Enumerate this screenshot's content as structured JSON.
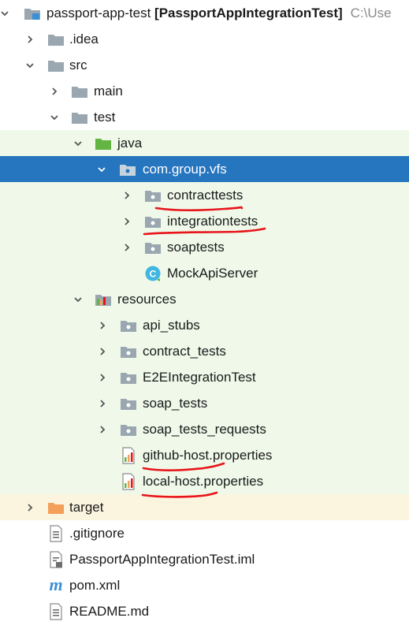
{
  "tree": {
    "root": {
      "label": "passport-app-test",
      "module": "[PassportAppIntegrationTest]",
      "path": "C:\\Use"
    },
    "idea": ".idea",
    "src": "src",
    "main": "main",
    "test": "test",
    "java": "java",
    "package": "com.group.vfs",
    "contracttests": "contracttests",
    "integrationtests": "integrationtests",
    "soaptests": "soaptests",
    "mock_server": "MockApiServer",
    "resources": "resources",
    "api_stubs": "api_stubs",
    "contract_tests": "contract_tests",
    "e2e": "E2EIntegrationTest",
    "soap_tests": "soap_tests",
    "soap_tests_requests": "soap_tests_requests",
    "github_props": "github-host.properties",
    "local_props": "local-host.properties",
    "target": "target",
    "gitignore": ".gitignore",
    "iml": "PassportAppIntegrationTest.iml",
    "pom": "pom.xml",
    "readme": "README.md"
  },
  "icons": {
    "class_badge": "C",
    "pom_badge": "m"
  },
  "colors": {
    "selection": "#2675bf",
    "test_source_bg": "#eff8e9",
    "excluded_bg": "#fbf5df",
    "folder": "#9aa7b0",
    "test_folder": "#62b543",
    "excluded_folder": "#f4a05a",
    "annotation_red": "#e8141a"
  }
}
